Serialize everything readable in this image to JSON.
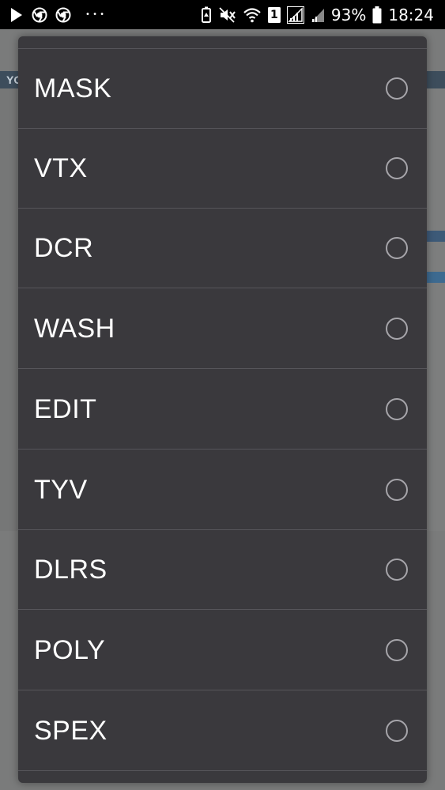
{
  "status_bar": {
    "left_icons": [
      "play-store-icon",
      "chrome-icon",
      "chrome-icon",
      "more-dots-icon"
    ],
    "more_label": "• • •",
    "right_icons": [
      "battery-saver-icon",
      "mute-icon",
      "wifi-icon",
      "sim1-icon",
      "signal-icon"
    ],
    "sim_label": "1",
    "battery_percent": "93%",
    "time": "18:24"
  },
  "background_page": {
    "header_text": "YO"
  },
  "dialog": {
    "options": [
      {
        "label": "MASK",
        "selected": false
      },
      {
        "label": "VTX",
        "selected": false
      },
      {
        "label": "DCR",
        "selected": false
      },
      {
        "label": "WASH",
        "selected": false
      },
      {
        "label": "EDIT",
        "selected": false
      },
      {
        "label": "TYV",
        "selected": false
      },
      {
        "label": "DLRS",
        "selected": false
      },
      {
        "label": "POLY",
        "selected": false
      },
      {
        "label": "SPEX",
        "selected": false
      }
    ]
  },
  "colors": {
    "dialog_bg": "#3a393d",
    "divider": "#56555a",
    "radio_ring": "#a6a5aa",
    "text": "#ffffff",
    "status_bar_bg": "#000000"
  }
}
